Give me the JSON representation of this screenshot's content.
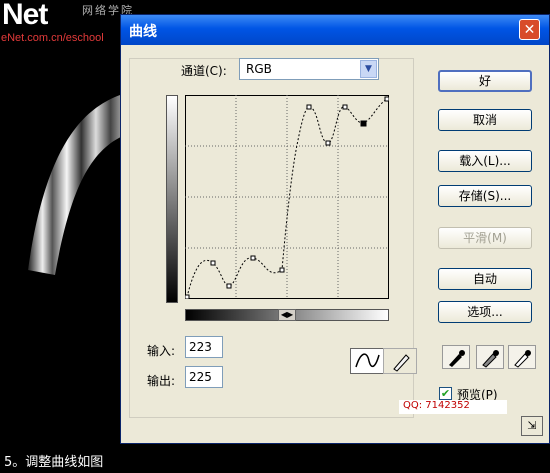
{
  "background": {
    "logo_text": "Net",
    "logo_subtext": "网络学院",
    "logo_url": "eNet.com.cn/eschool",
    "caption": "5。调整曲线如图"
  },
  "dialog": {
    "title": "曲线",
    "channel_label": "通道(C):",
    "channel_value": "RGB",
    "input_label": "输入:",
    "input_value": "223",
    "output_label": "输出:",
    "output_value": "225",
    "buttons": {
      "ok": "好",
      "cancel": "取消",
      "load": "载入(L)...",
      "save": "存储(S)...",
      "smooth": "平滑(M)",
      "auto": "自动",
      "options": "选项..."
    },
    "preview_label": "预览(P)",
    "preview_checked": true,
    "watermark": "QQ: 7142352"
  }
}
